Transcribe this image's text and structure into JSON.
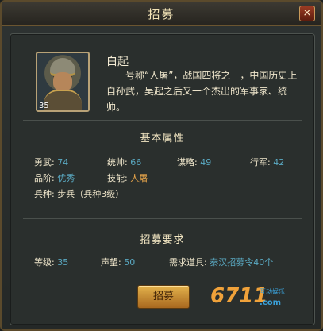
{
  "window": {
    "title": "招募",
    "close_label": "×"
  },
  "hero": {
    "level": "35",
    "name": "白起",
    "description": "号称“人屠”，战国四将之一，中国历史上自孙武，吴起之后又一个杰出的军事家、统帅。"
  },
  "attributes": {
    "section_title": "基本属性",
    "items": [
      {
        "label": "勇武:",
        "value": "74"
      },
      {
        "label": "统帅:",
        "value": "66"
      },
      {
        "label": "谋略:",
        "value": "49"
      },
      {
        "label": "行军:",
        "value": "42"
      },
      {
        "label": "品阶:",
        "value": "优秀"
      },
      {
        "label": "技能:",
        "value": "人屠"
      },
      {
        "label": "兵种:",
        "value": "步兵（兵种3级）"
      }
    ]
  },
  "requirements": {
    "section_title": "招募要求",
    "items": [
      {
        "label": "等级:",
        "value": "35"
      },
      {
        "label": "声望:",
        "value": "50"
      },
      {
        "label": "需求道具:",
        "value": "秦汉招募令40个"
      }
    ]
  },
  "recruit_button": "招募",
  "watermark": {
    "number": "6711",
    "site": ".com",
    "tag": "互动娱乐"
  }
}
